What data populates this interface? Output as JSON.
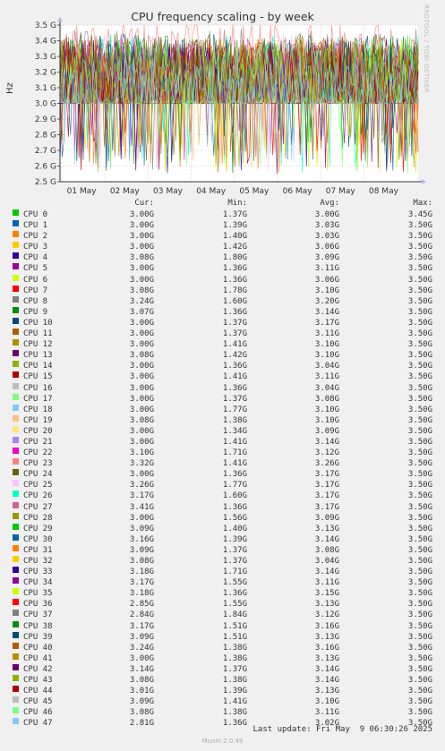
{
  "chart_data": {
    "type": "line",
    "title": "CPU frequency scaling - by week",
    "ylabel": "Hz",
    "ylim": [
      2.5,
      3.5
    ],
    "y_ticks": [
      "2.5 G",
      "2.6 G",
      "2.7 G",
      "2.8 G",
      "2.9 G",
      "3.0 G",
      "3.1 G",
      "3.2 G",
      "3.3 G",
      "3.4 G",
      "3.5 G"
    ],
    "x_ticks": [
      "01 May",
      "02 May",
      "03 May",
      "04 May",
      "05 May",
      "06 May",
      "07 May",
      "08 May"
    ],
    "grid": true,
    "legend_columns": [
      "Cur:",
      "Min:",
      "Avg:",
      "Max:"
    ],
    "series": [
      {
        "name": "CPU 0",
        "color": "#00cc00",
        "cur": "3.00G",
        "min": "1.37G",
        "avg": "3.00G",
        "max": "3.45G"
      },
      {
        "name": "CPU 1",
        "color": "#0066b3",
        "cur": "3.00G",
        "min": "1.39G",
        "avg": "3.03G",
        "max": "3.50G"
      },
      {
        "name": "CPU 2",
        "color": "#ff8000",
        "cur": "3.00G",
        "min": "1.40G",
        "avg": "3.03G",
        "max": "3.50G"
      },
      {
        "name": "CPU 3",
        "color": "#ffcc00",
        "cur": "3.00G",
        "min": "1.42G",
        "avg": "3.06G",
        "max": "3.50G"
      },
      {
        "name": "CPU 4",
        "color": "#330099",
        "cur": "3.08G",
        "min": "1.80G",
        "avg": "3.09G",
        "max": "3.50G"
      },
      {
        "name": "CPU 5",
        "color": "#990099",
        "cur": "3.00G",
        "min": "1.36G",
        "avg": "3.11G",
        "max": "3.50G"
      },
      {
        "name": "CPU 6",
        "color": "#ccff00",
        "cur": "3.00G",
        "min": "1.36G",
        "avg": "3.06G",
        "max": "3.50G"
      },
      {
        "name": "CPU 7",
        "color": "#ff0000",
        "cur": "3.08G",
        "min": "1.78G",
        "avg": "3.10G",
        "max": "3.50G"
      },
      {
        "name": "CPU 8",
        "color": "#808080",
        "cur": "3.24G",
        "min": "1.60G",
        "avg": "3.20G",
        "max": "3.50G"
      },
      {
        "name": "CPU 9",
        "color": "#008f00",
        "cur": "3.07G",
        "min": "1.36G",
        "avg": "3.14G",
        "max": "3.50G"
      },
      {
        "name": "CPU 10",
        "color": "#00487d",
        "cur": "3.00G",
        "min": "1.37G",
        "avg": "3.17G",
        "max": "3.50G"
      },
      {
        "name": "CPU 11",
        "color": "#b35a00",
        "cur": "3.00G",
        "min": "1.37G",
        "avg": "3.11G",
        "max": "3.50G"
      },
      {
        "name": "CPU 12",
        "color": "#b38f00",
        "cur": "3.00G",
        "min": "1.41G",
        "avg": "3.10G",
        "max": "3.50G"
      },
      {
        "name": "CPU 13",
        "color": "#6b006b",
        "cur": "3.08G",
        "min": "1.42G",
        "avg": "3.10G",
        "max": "3.50G"
      },
      {
        "name": "CPU 14",
        "color": "#8fb300",
        "cur": "3.00G",
        "min": "1.36G",
        "avg": "3.04G",
        "max": "3.50G"
      },
      {
        "name": "CPU 15",
        "color": "#b30000",
        "cur": "3.00G",
        "min": "1.41G",
        "avg": "3.11G",
        "max": "3.50G"
      },
      {
        "name": "CPU 16",
        "color": "#bebebe",
        "cur": "3.00G",
        "min": "1.36G",
        "avg": "3.04G",
        "max": "3.50G"
      },
      {
        "name": "CPU 17",
        "color": "#80ff80",
        "cur": "3.00G",
        "min": "1.37G",
        "avg": "3.08G",
        "max": "3.50G"
      },
      {
        "name": "CPU 18",
        "color": "#80c9ff",
        "cur": "3.00G",
        "min": "1.77G",
        "avg": "3.10G",
        "max": "3.50G"
      },
      {
        "name": "CPU 19",
        "color": "#ffc080",
        "cur": "3.08G",
        "min": "1.38G",
        "avg": "3.10G",
        "max": "3.50G"
      },
      {
        "name": "CPU 20",
        "color": "#ffe680",
        "cur": "3.00G",
        "min": "1.34G",
        "avg": "3.09G",
        "max": "3.50G"
      },
      {
        "name": "CPU 21",
        "color": "#aa80ff",
        "cur": "3.00G",
        "min": "1.41G",
        "avg": "3.14G",
        "max": "3.50G"
      },
      {
        "name": "CPU 22",
        "color": "#ee00cc",
        "cur": "3.10G",
        "min": "1.71G",
        "avg": "3.12G",
        "max": "3.50G"
      },
      {
        "name": "CPU 23",
        "color": "#ff8080",
        "cur": "3.32G",
        "min": "1.41G",
        "avg": "3.26G",
        "max": "3.50G"
      },
      {
        "name": "CPU 24",
        "color": "#666600",
        "cur": "3.00G",
        "min": "1.36G",
        "avg": "3.17G",
        "max": "3.50G"
      },
      {
        "name": "CPU 25",
        "color": "#ffbfff",
        "cur": "3.26G",
        "min": "1.77G",
        "avg": "3.17G",
        "max": "3.50G"
      },
      {
        "name": "CPU 26",
        "color": "#00ffcc",
        "cur": "3.17G",
        "min": "1.60G",
        "avg": "3.17G",
        "max": "3.50G"
      },
      {
        "name": "CPU 27",
        "color": "#cc6699",
        "cur": "3.41G",
        "min": "1.36G",
        "avg": "3.17G",
        "max": "3.50G"
      },
      {
        "name": "CPU 28",
        "color": "#999900",
        "cur": "3.00G",
        "min": "1.56G",
        "avg": "3.09G",
        "max": "3.50G"
      },
      {
        "name": "CPU 29",
        "color": "#00cc00",
        "cur": "3.09G",
        "min": "1.40G",
        "avg": "3.13G",
        "max": "3.50G"
      },
      {
        "name": "CPU 30",
        "color": "#0066b3",
        "cur": "3.16G",
        "min": "1.39G",
        "avg": "3.14G",
        "max": "3.50G"
      },
      {
        "name": "CPU 31",
        "color": "#ff8000",
        "cur": "3.09G",
        "min": "1.37G",
        "avg": "3.08G",
        "max": "3.50G"
      },
      {
        "name": "CPU 32",
        "color": "#ffcc00",
        "cur": "3.08G",
        "min": "1.37G",
        "avg": "3.04G",
        "max": "3.50G"
      },
      {
        "name": "CPU 33",
        "color": "#330099",
        "cur": "3.18G",
        "min": "1.71G",
        "avg": "3.14G",
        "max": "3.50G"
      },
      {
        "name": "CPU 34",
        "color": "#990099",
        "cur": "3.17G",
        "min": "1.55G",
        "avg": "3.11G",
        "max": "3.50G"
      },
      {
        "name": "CPU 35",
        "color": "#ccff00",
        "cur": "3.18G",
        "min": "1.36G",
        "avg": "3.15G",
        "max": "3.50G"
      },
      {
        "name": "CPU 36",
        "color": "#ff0000",
        "cur": "2.85G",
        "min": "1.55G",
        "avg": "3.13G",
        "max": "3.50G"
      },
      {
        "name": "CPU 37",
        "color": "#808080",
        "cur": "2.84G",
        "min": "1.84G",
        "avg": "3.12G",
        "max": "3.50G"
      },
      {
        "name": "CPU 38",
        "color": "#008f00",
        "cur": "3.17G",
        "min": "1.51G",
        "avg": "3.16G",
        "max": "3.50G"
      },
      {
        "name": "CPU 39",
        "color": "#00487d",
        "cur": "3.09G",
        "min": "1.51G",
        "avg": "3.13G",
        "max": "3.50G"
      },
      {
        "name": "CPU 40",
        "color": "#b35a00",
        "cur": "3.24G",
        "min": "1.38G",
        "avg": "3.16G",
        "max": "3.50G"
      },
      {
        "name": "CPU 41",
        "color": "#b38f00",
        "cur": "3.00G",
        "min": "1.38G",
        "avg": "3.13G",
        "max": "3.50G"
      },
      {
        "name": "CPU 42",
        "color": "#6b006b",
        "cur": "3.14G",
        "min": "1.37G",
        "avg": "3.14G",
        "max": "3.50G"
      },
      {
        "name": "CPU 43",
        "color": "#8fb300",
        "cur": "3.08G",
        "min": "1.38G",
        "avg": "3.14G",
        "max": "3.50G"
      },
      {
        "name": "CPU 44",
        "color": "#b30000",
        "cur": "3.01G",
        "min": "1.39G",
        "avg": "3.13G",
        "max": "3.50G"
      },
      {
        "name": "CPU 45",
        "color": "#bebebe",
        "cur": "3.09G",
        "min": "1.41G",
        "avg": "3.10G",
        "max": "3.50G"
      },
      {
        "name": "CPU 46",
        "color": "#80ff80",
        "cur": "3.08G",
        "min": "1.38G",
        "avg": "3.11G",
        "max": "3.50G"
      },
      {
        "name": "CPU 47",
        "color": "#80c9ff",
        "cur": "2.81G",
        "min": "1.36G",
        "avg": "3.02G",
        "max": "3.50G"
      }
    ]
  },
  "side_label": "RRDTOOL / TOBI OETIKER",
  "last_update": "Last update: Fri May  9 06:30:26 2025",
  "footer": "Munin 2.0.49"
}
